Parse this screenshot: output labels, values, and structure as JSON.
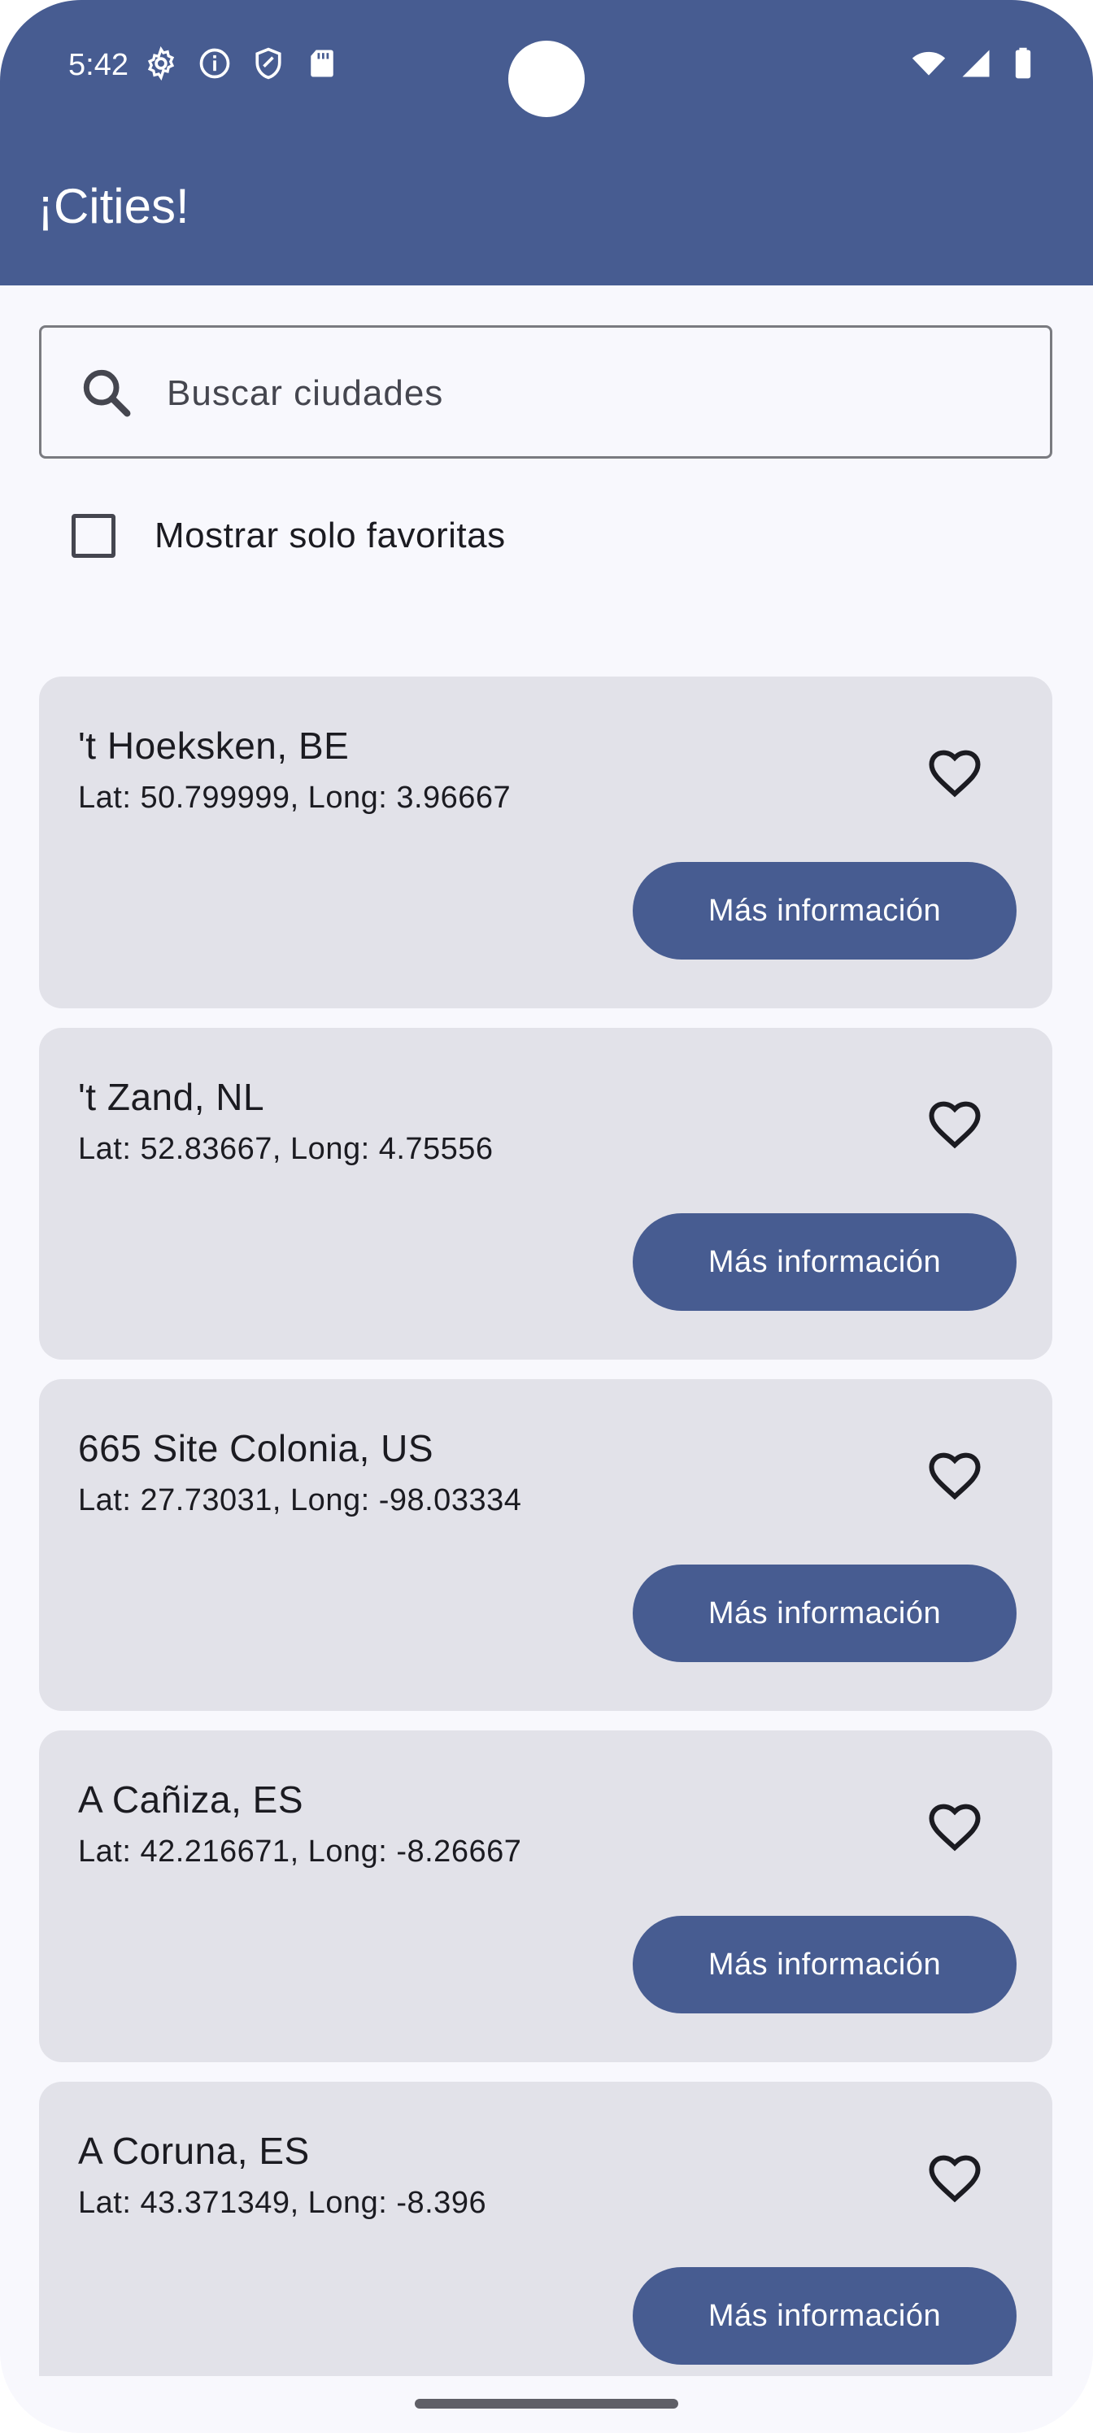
{
  "status_bar": {
    "time": "5:42",
    "left_icons": [
      "gear-icon",
      "info-icon",
      "shield-icon",
      "sd-card-icon"
    ],
    "right_icons": [
      "wifi-icon",
      "signal-icon",
      "battery-icon"
    ]
  },
  "app_bar": {
    "title": "¡Cities!"
  },
  "search": {
    "placeholder": "Buscar ciudades",
    "value": ""
  },
  "filter": {
    "label": "Mostrar solo favoritas",
    "checked": false
  },
  "cities": [
    {
      "name": "'t Hoeksken, BE",
      "coords": "Lat: 50.799999, Long: 3.96667",
      "favorite": false,
      "button_label": "Más información"
    },
    {
      "name": "'t Zand, NL",
      "coords": "Lat: 52.83667, Long: 4.75556",
      "favorite": false,
      "button_label": "Más información"
    },
    {
      "name": "665 Site Colonia, US",
      "coords": "Lat: 27.73031, Long: -98.03334",
      "favorite": false,
      "button_label": "Más información"
    },
    {
      "name": "A Cañiza, ES",
      "coords": "Lat: 42.216671, Long: -8.26667",
      "favorite": false,
      "button_label": "Más información"
    },
    {
      "name": "A Coruna, ES",
      "coords": "Lat: 43.371349, Long: -8.396",
      "favorite": false,
      "button_label": "Más información"
    }
  ],
  "colors": {
    "primary": "#475c91",
    "card_background": "#e2e2e9",
    "screen_background": "#f8f8fd"
  }
}
